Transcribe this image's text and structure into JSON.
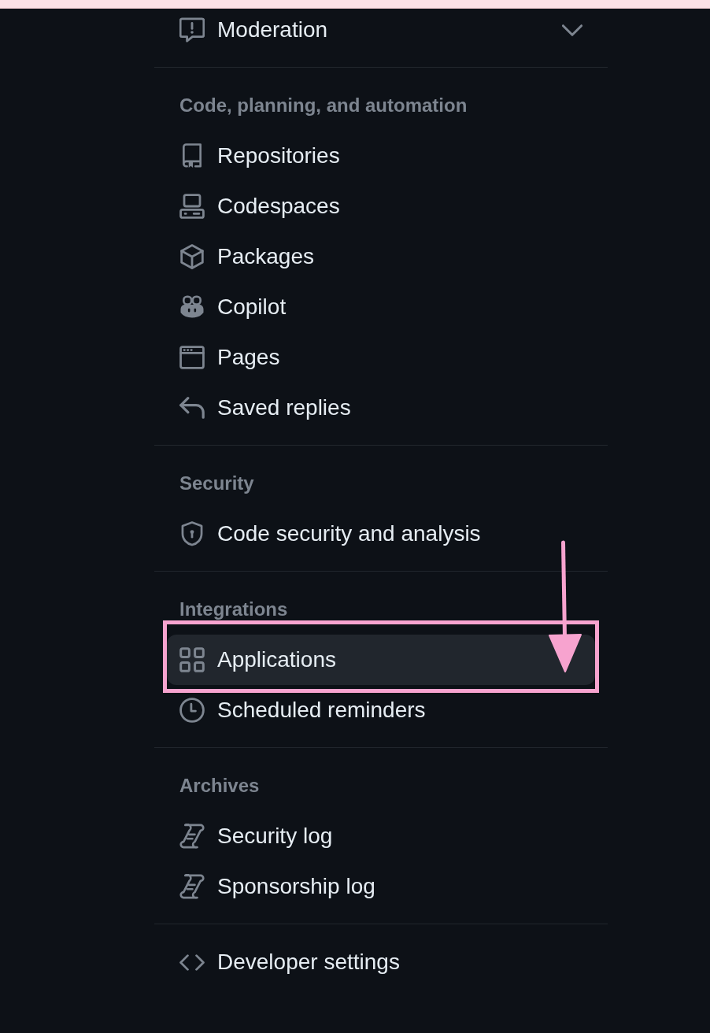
{
  "top_item": {
    "label": "Moderation",
    "selected": false,
    "expanded": false
  },
  "sections": [
    {
      "heading": "Code, planning, and automation",
      "items": [
        {
          "label": "Repositories",
          "selected": false,
          "annotated": false
        },
        {
          "label": "Codespaces",
          "selected": false,
          "annotated": false
        },
        {
          "label": "Packages",
          "selected": false,
          "annotated": false
        },
        {
          "label": "Copilot",
          "selected": false,
          "annotated": false
        },
        {
          "label": "Pages",
          "selected": false,
          "annotated": false
        },
        {
          "label": "Saved replies",
          "selected": false,
          "annotated": false
        }
      ]
    },
    {
      "heading": "Security",
      "items": [
        {
          "label": "Code security and analysis",
          "selected": false,
          "annotated": false
        }
      ]
    },
    {
      "heading": "Integrations",
      "items": [
        {
          "label": "Applications",
          "selected": true,
          "annotated": true
        },
        {
          "label": "Scheduled reminders",
          "selected": false,
          "annotated": false
        }
      ]
    },
    {
      "heading": "Archives",
      "items": [
        {
          "label": "Security log",
          "selected": false,
          "annotated": false
        },
        {
          "label": "Sponsorship log",
          "selected": false,
          "annotated": false
        }
      ]
    }
  ],
  "footer_item": {
    "label": "Developer settings",
    "selected": false
  }
}
